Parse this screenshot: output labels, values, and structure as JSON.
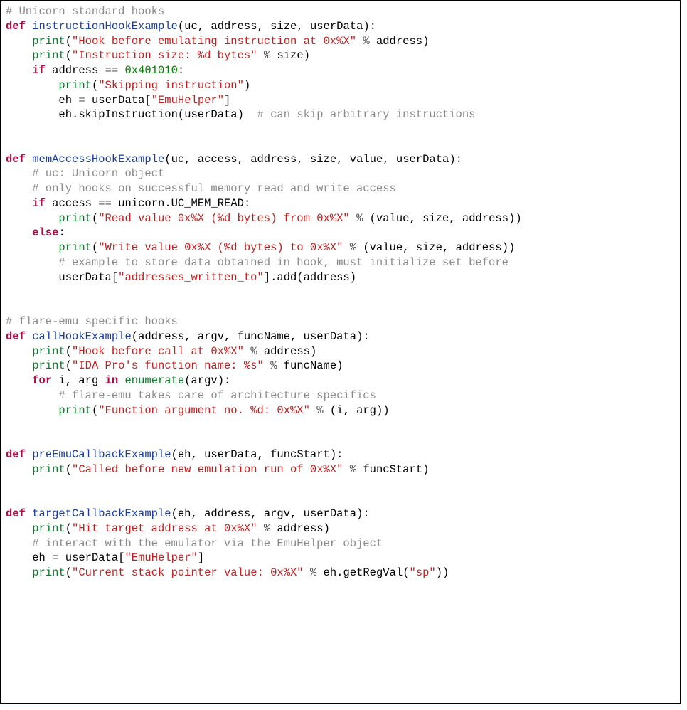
{
  "code": {
    "tokens": [
      [
        [
          "c",
          "# Unicorn standard hooks"
        ]
      ],
      [
        [
          "kd",
          "def"
        ],
        [
          "p",
          " "
        ],
        [
          "nf",
          "instructionHookExample"
        ],
        [
          "p",
          "("
        ],
        [
          "n",
          "uc"
        ],
        [
          "p",
          ", "
        ],
        [
          "n",
          "address"
        ],
        [
          "p",
          ", "
        ],
        [
          "n",
          "size"
        ],
        [
          "p",
          ", "
        ],
        [
          "n",
          "userData"
        ],
        [
          "p",
          "):"
        ]
      ],
      [
        [
          "p",
          "    "
        ],
        [
          "nb",
          "print"
        ],
        [
          "p",
          "("
        ],
        [
          "s",
          "\"Hook before emulating instruction at 0x%X\""
        ],
        [
          "p",
          " "
        ],
        [
          "o",
          "%"
        ],
        [
          "p",
          " "
        ],
        [
          "n",
          "address"
        ],
        [
          "p",
          ")"
        ]
      ],
      [
        [
          "p",
          "    "
        ],
        [
          "nb",
          "print"
        ],
        [
          "p",
          "("
        ],
        [
          "s",
          "\"Instruction size: %d bytes\""
        ],
        [
          "p",
          " "
        ],
        [
          "o",
          "%"
        ],
        [
          "p",
          " "
        ],
        [
          "n",
          "size"
        ],
        [
          "p",
          ")"
        ]
      ],
      [
        [
          "p",
          "    "
        ],
        [
          "k",
          "if"
        ],
        [
          "p",
          " "
        ],
        [
          "n",
          "address"
        ],
        [
          "p",
          " "
        ],
        [
          "o",
          "=="
        ],
        [
          "p",
          " "
        ],
        [
          "mi",
          "0x401010"
        ],
        [
          "p",
          ":"
        ]
      ],
      [
        [
          "p",
          "        "
        ],
        [
          "nb",
          "print"
        ],
        [
          "p",
          "("
        ],
        [
          "s",
          "\"Skipping instruction\""
        ],
        [
          "p",
          ")"
        ]
      ],
      [
        [
          "p",
          "        "
        ],
        [
          "n",
          "eh"
        ],
        [
          "p",
          " "
        ],
        [
          "o",
          "="
        ],
        [
          "p",
          " "
        ],
        [
          "n",
          "userData"
        ],
        [
          "p",
          "["
        ],
        [
          "s",
          "\"EmuHelper\""
        ],
        [
          "p",
          "]"
        ]
      ],
      [
        [
          "p",
          "        "
        ],
        [
          "n",
          "eh"
        ],
        [
          "p",
          "."
        ],
        [
          "na",
          "skipInstruction"
        ],
        [
          "p",
          "("
        ],
        [
          "n",
          "userData"
        ],
        [
          "p",
          ")  "
        ],
        [
          "c",
          "# can skip arbitrary instructions"
        ]
      ],
      [],
      [],
      [
        [
          "kd",
          "def"
        ],
        [
          "p",
          " "
        ],
        [
          "nf",
          "memAccessHookExample"
        ],
        [
          "p",
          "("
        ],
        [
          "n",
          "uc"
        ],
        [
          "p",
          ", "
        ],
        [
          "n",
          "access"
        ],
        [
          "p",
          ", "
        ],
        [
          "n",
          "address"
        ],
        [
          "p",
          ", "
        ],
        [
          "n",
          "size"
        ],
        [
          "p",
          ", "
        ],
        [
          "n",
          "value"
        ],
        [
          "p",
          ", "
        ],
        [
          "n",
          "userData"
        ],
        [
          "p",
          "):"
        ]
      ],
      [
        [
          "p",
          "    "
        ],
        [
          "c",
          "# uc: Unicorn object"
        ]
      ],
      [
        [
          "p",
          "    "
        ],
        [
          "c",
          "# only hooks on successful memory read and write access"
        ]
      ],
      [
        [
          "p",
          "    "
        ],
        [
          "k",
          "if"
        ],
        [
          "p",
          " "
        ],
        [
          "n",
          "access"
        ],
        [
          "p",
          " "
        ],
        [
          "o",
          "=="
        ],
        [
          "p",
          " "
        ],
        [
          "n",
          "unicorn"
        ],
        [
          "p",
          "."
        ],
        [
          "n",
          "UC_MEM_READ"
        ],
        [
          "p",
          ":"
        ]
      ],
      [
        [
          "p",
          "        "
        ],
        [
          "nb",
          "print"
        ],
        [
          "p",
          "("
        ],
        [
          "s",
          "\"Read value 0x%X (%d bytes) from 0x%X\""
        ],
        [
          "p",
          " "
        ],
        [
          "o",
          "%"
        ],
        [
          "p",
          " ("
        ],
        [
          "n",
          "value"
        ],
        [
          "p",
          ", "
        ],
        [
          "n",
          "size"
        ],
        [
          "p",
          ", "
        ],
        [
          "n",
          "address"
        ],
        [
          "p",
          "))"
        ]
      ],
      [
        [
          "p",
          "    "
        ],
        [
          "k",
          "else"
        ],
        [
          "p",
          ":"
        ]
      ],
      [
        [
          "p",
          "        "
        ],
        [
          "nb",
          "print"
        ],
        [
          "p",
          "("
        ],
        [
          "s",
          "\"Write value 0x%X (%d bytes) to 0x%X\""
        ],
        [
          "p",
          " "
        ],
        [
          "o",
          "%"
        ],
        [
          "p",
          " ("
        ],
        [
          "n",
          "value"
        ],
        [
          "p",
          ", "
        ],
        [
          "n",
          "size"
        ],
        [
          "p",
          ", "
        ],
        [
          "n",
          "address"
        ],
        [
          "p",
          "))"
        ]
      ],
      [
        [
          "p",
          "        "
        ],
        [
          "c",
          "# example to store data obtained in hook, must initialize set before"
        ]
      ],
      [
        [
          "p",
          "        "
        ],
        [
          "n",
          "userData"
        ],
        [
          "p",
          "["
        ],
        [
          "s",
          "\"addresses_written_to\""
        ],
        [
          "p",
          "]."
        ],
        [
          "na",
          "add"
        ],
        [
          "p",
          "("
        ],
        [
          "n",
          "address"
        ],
        [
          "p",
          ")"
        ]
      ],
      [],
      [],
      [
        [
          "c",
          "# flare-emu specific hooks"
        ]
      ],
      [
        [
          "kd",
          "def"
        ],
        [
          "p",
          " "
        ],
        [
          "nf",
          "callHookExample"
        ],
        [
          "p",
          "("
        ],
        [
          "n",
          "address"
        ],
        [
          "p",
          ", "
        ],
        [
          "n",
          "argv"
        ],
        [
          "p",
          ", "
        ],
        [
          "n",
          "funcName"
        ],
        [
          "p",
          ", "
        ],
        [
          "n",
          "userData"
        ],
        [
          "p",
          "):"
        ]
      ],
      [
        [
          "p",
          "    "
        ],
        [
          "nb",
          "print"
        ],
        [
          "p",
          "("
        ],
        [
          "s",
          "\"Hook before call at 0x%X\""
        ],
        [
          "p",
          " "
        ],
        [
          "o",
          "%"
        ],
        [
          "p",
          " "
        ],
        [
          "n",
          "address"
        ],
        [
          "p",
          ")"
        ]
      ],
      [
        [
          "p",
          "    "
        ],
        [
          "nb",
          "print"
        ],
        [
          "p",
          "("
        ],
        [
          "s",
          "\"IDA Pro's function name: %s\""
        ],
        [
          "p",
          " "
        ],
        [
          "o",
          "%"
        ],
        [
          "p",
          " "
        ],
        [
          "n",
          "funcName"
        ],
        [
          "p",
          ")"
        ]
      ],
      [
        [
          "p",
          "    "
        ],
        [
          "k",
          "for"
        ],
        [
          "p",
          " "
        ],
        [
          "n",
          "i"
        ],
        [
          "p",
          ", "
        ],
        [
          "n",
          "arg"
        ],
        [
          "p",
          " "
        ],
        [
          "k",
          "in"
        ],
        [
          "p",
          " "
        ],
        [
          "nb",
          "enumerate"
        ],
        [
          "p",
          "("
        ],
        [
          "n",
          "argv"
        ],
        [
          "p",
          "):"
        ]
      ],
      [
        [
          "p",
          "        "
        ],
        [
          "c",
          "# flare-emu takes care of architecture specifics"
        ]
      ],
      [
        [
          "p",
          "        "
        ],
        [
          "nb",
          "print"
        ],
        [
          "p",
          "("
        ],
        [
          "s",
          "\"Function argument no. %d: 0x%X\""
        ],
        [
          "p",
          " "
        ],
        [
          "o",
          "%"
        ],
        [
          "p",
          " ("
        ],
        [
          "n",
          "i"
        ],
        [
          "p",
          ", "
        ],
        [
          "n",
          "arg"
        ],
        [
          "p",
          "))"
        ]
      ],
      [],
      [],
      [
        [
          "kd",
          "def"
        ],
        [
          "p",
          " "
        ],
        [
          "nf",
          "preEmuCallbackExample"
        ],
        [
          "p",
          "("
        ],
        [
          "n",
          "eh"
        ],
        [
          "p",
          ", "
        ],
        [
          "n",
          "userData"
        ],
        [
          "p",
          ", "
        ],
        [
          "n",
          "funcStart"
        ],
        [
          "p",
          "):"
        ]
      ],
      [
        [
          "p",
          "    "
        ],
        [
          "nb",
          "print"
        ],
        [
          "p",
          "("
        ],
        [
          "s",
          "\"Called before new emulation run of 0x%X\""
        ],
        [
          "p",
          " "
        ],
        [
          "o",
          "%"
        ],
        [
          "p",
          " "
        ],
        [
          "n",
          "funcStart"
        ],
        [
          "p",
          ")"
        ]
      ],
      [],
      [],
      [
        [
          "kd",
          "def"
        ],
        [
          "p",
          " "
        ],
        [
          "nf",
          "targetCallbackExample"
        ],
        [
          "p",
          "("
        ],
        [
          "n",
          "eh"
        ],
        [
          "p",
          ", "
        ],
        [
          "n",
          "address"
        ],
        [
          "p",
          ", "
        ],
        [
          "n",
          "argv"
        ],
        [
          "p",
          ", "
        ],
        [
          "n",
          "userData"
        ],
        [
          "p",
          "):"
        ]
      ],
      [
        [
          "p",
          "    "
        ],
        [
          "nb",
          "print"
        ],
        [
          "p",
          "("
        ],
        [
          "s",
          "\"Hit target address at 0x%X\""
        ],
        [
          "p",
          " "
        ],
        [
          "o",
          "%"
        ],
        [
          "p",
          " "
        ],
        [
          "n",
          "address"
        ],
        [
          "p",
          ")"
        ]
      ],
      [
        [
          "p",
          "    "
        ],
        [
          "c",
          "# interact with the emulator via the EmuHelper object"
        ]
      ],
      [
        [
          "p",
          "    "
        ],
        [
          "n",
          "eh"
        ],
        [
          "p",
          " "
        ],
        [
          "o",
          "="
        ],
        [
          "p",
          " "
        ],
        [
          "n",
          "userData"
        ],
        [
          "p",
          "["
        ],
        [
          "s",
          "\"EmuHelper\""
        ],
        [
          "p",
          "]"
        ]
      ],
      [
        [
          "p",
          "    "
        ],
        [
          "nb",
          "print"
        ],
        [
          "p",
          "("
        ],
        [
          "s",
          "\"Current stack pointer value: 0x%X\""
        ],
        [
          "p",
          " "
        ],
        [
          "o",
          "%"
        ],
        [
          "p",
          " "
        ],
        [
          "n",
          "eh"
        ],
        [
          "p",
          "."
        ],
        [
          "na",
          "getRegVal"
        ],
        [
          "p",
          "("
        ],
        [
          "s",
          "\"sp\""
        ],
        [
          "p",
          "))"
        ]
      ]
    ]
  }
}
